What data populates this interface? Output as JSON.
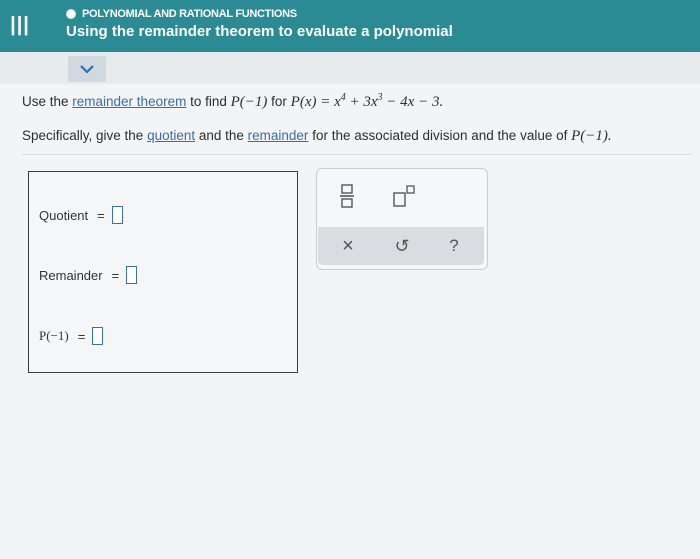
{
  "header": {
    "topic": "POLYNOMIAL AND RATIONAL FUNCTIONS",
    "title": "Using the remainder theorem to evaluate a polynomial",
    "menu_glyph": "|||",
    "colors": {
      "bar": "#2a8b95",
      "link": "#3a6ea5"
    }
  },
  "question": {
    "line1_prefix": "Use the ",
    "line1_link": "remainder theorem",
    "line1_mid": " to find ",
    "line1_target": "P(−1)",
    "line1_for": " for ",
    "poly_lhs": "P(x) = x",
    "poly_exp1": "4",
    "poly_mid": " + 3x",
    "poly_exp2": "3",
    "poly_tail": " − 4x − 3.",
    "line2_prefix": "Specifically, give the ",
    "line2_link1": "quotient",
    "line2_mid": " and the ",
    "line2_link2": "remainder",
    "line2_suffix": " for the associated division and the value of ",
    "line2_target": "P(−1)."
  },
  "answers": {
    "quotient_label": "Quotient",
    "remainder_label": "Remainder",
    "p_label": "P(−1)",
    "equals": "="
  },
  "toolbar": {
    "fraction_icon": "fraction-icon",
    "exponent_icon": "exponent-icon",
    "clear_glyph": "×",
    "undo_glyph": "↺",
    "help_glyph": "?"
  }
}
